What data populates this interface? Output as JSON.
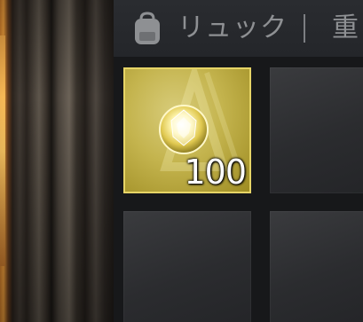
{
  "header": {
    "tab_label": "リュック",
    "next_tab_label": "重",
    "bag_icon": "backpack-icon"
  },
  "inventory": {
    "slots": [
      {
        "item": "gem-icon",
        "quantity": "100",
        "rarity_color": "#c4b44e"
      },
      {
        "item": null
      },
      {
        "item": null
      },
      {
        "item": null
      }
    ]
  },
  "colors": {
    "accent_gold": "#e6d466",
    "header_text": "#8e9093",
    "panel_bg": "#17181a"
  }
}
